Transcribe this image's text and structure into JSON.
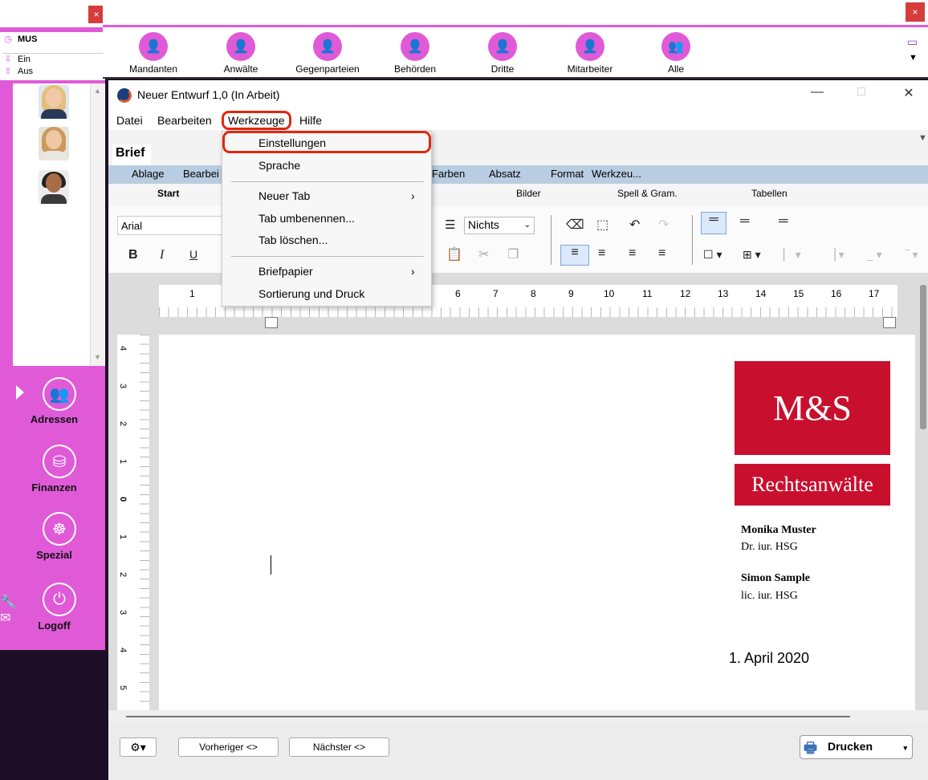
{
  "sidebar": {
    "close": "×",
    "user": "MUS",
    "ein": "Ein",
    "aus": "Aus",
    "nav": [
      {
        "label": "Adressen",
        "icon": "people-icon"
      },
      {
        "label": "Finanzen",
        "icon": "coins-icon"
      },
      {
        "label": "Spezial",
        "icon": "helm-icon"
      },
      {
        "label": "Logoff",
        "icon": "power-icon"
      }
    ]
  },
  "topbar": {
    "close": "×",
    "items": [
      "Mandanten",
      "Anwälte",
      "Gegenparteien",
      "Behörden",
      "Dritte",
      "Mitarbeiter",
      "Alle"
    ]
  },
  "window": {
    "title": "Neuer Entwurf 1,0 (In Arbeit)",
    "minimize": "—",
    "maximize": "□",
    "close": "✕"
  },
  "menubar": {
    "datei": "Datei",
    "bearbeiten": "Bearbeiten",
    "werkzeuge": "Werkzeuge",
    "hilfe": "Hilfe"
  },
  "dropdown": {
    "einstellungen": "Einstellungen",
    "sprache": "Sprache",
    "neuer_tab": "Neuer Tab",
    "tab_umbenennen": "Tab umbenennen...",
    "tab_loeschen": "Tab löschen...",
    "briefpapier": "Briefpapier",
    "sortierung": "Sortierung und Druck"
  },
  "doc_tab": "Brief",
  "ribbon_menu": {
    "ablage": "Ablage",
    "bearbeiten": "Bearbei",
    "farben": "Farben",
    "absatz": "Absatz",
    "format": "Format",
    "werkzeuge": "Werkzeu..."
  },
  "ribbon_tabs": {
    "start": "Start",
    "bilder": "Bilder",
    "spell": "Spell & Gram.",
    "tabellen": "Tabellen"
  },
  "toolbar": {
    "font": "Arial",
    "list_style": "Nichts",
    "bold": "B",
    "italic": "I",
    "underline": "U"
  },
  "ruler": [
    "1",
    "6",
    "7",
    "8",
    "9",
    "10",
    "11",
    "12",
    "13",
    "14",
    "15",
    "16",
    "17"
  ],
  "vruler": [
    "4",
    "3",
    "2",
    "1",
    "0",
    "1",
    "2",
    "3",
    "4",
    "5"
  ],
  "letter": {
    "logo_top": "M&S",
    "logo_bottom": "Rechtsanwälte",
    "name1": "Monika Muster",
    "title1": "Dr. iur. HSG",
    "name2": "Simon Sample",
    "title2": "lic. iur. HSG",
    "date": "1. April 2020"
  },
  "footer": {
    "prev": "Vorheriger <>",
    "next": "Nächster <>",
    "print": "Drucken"
  },
  "colors": {
    "accent": "#e05ad8",
    "highlight": "#e0280f",
    "logo": "#c8102e",
    "ribbon": "#b8cde1"
  }
}
